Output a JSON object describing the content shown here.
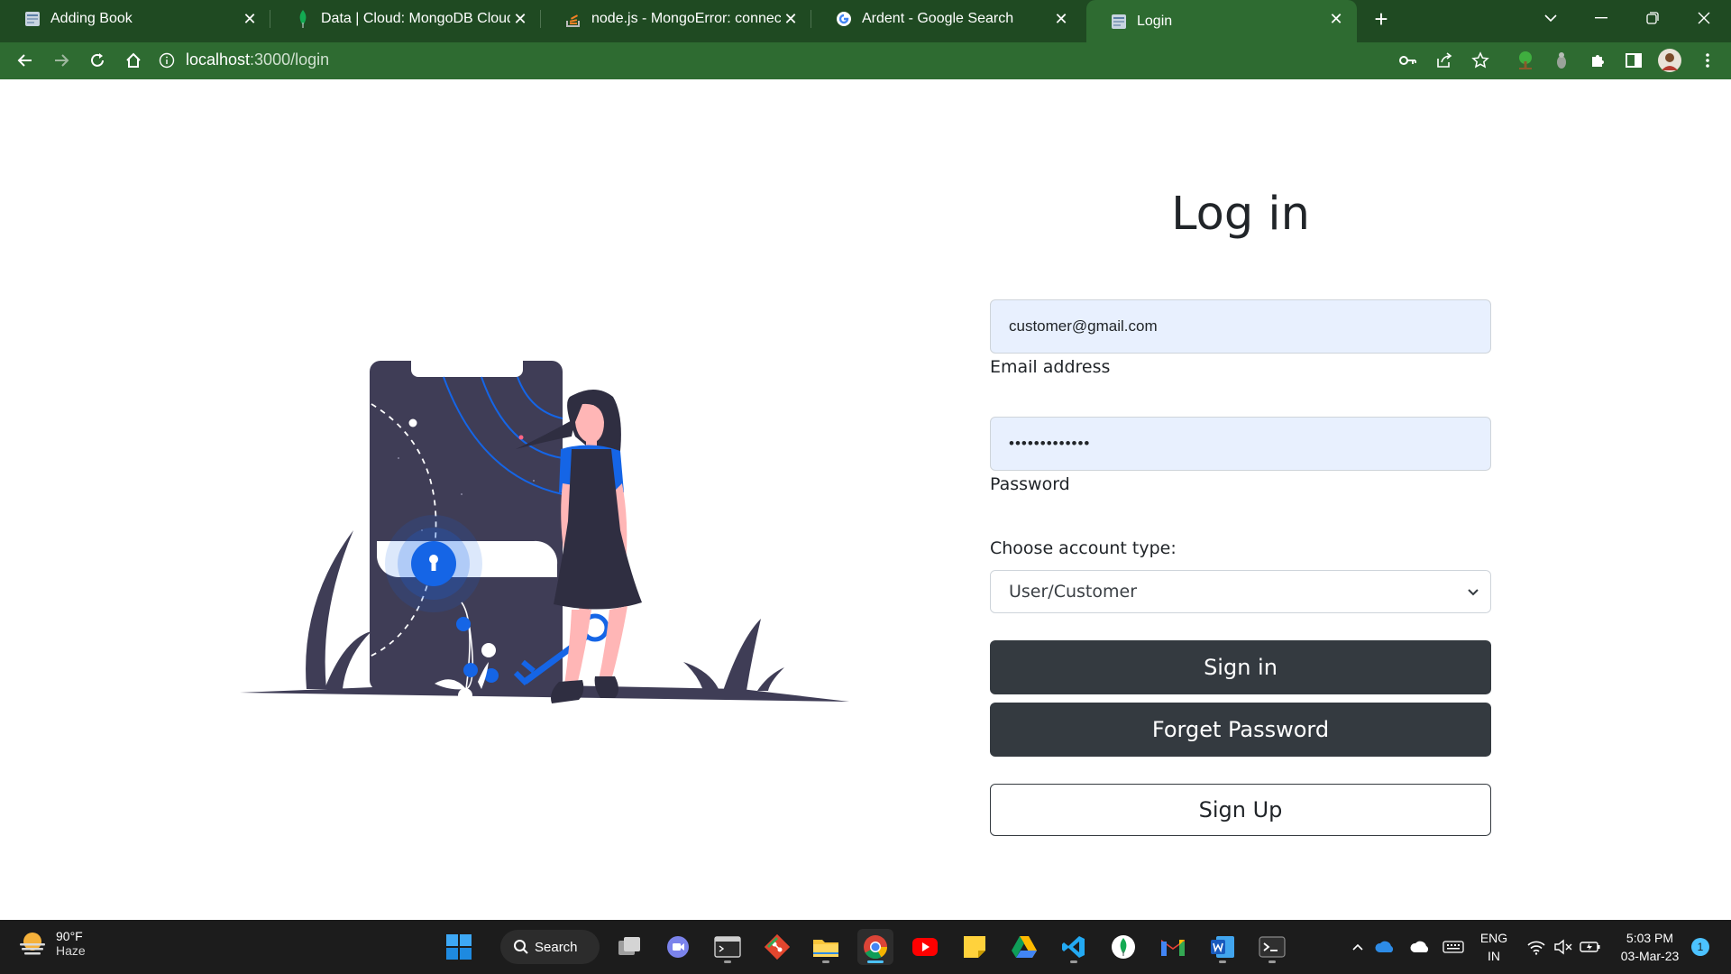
{
  "browser": {
    "tabs": [
      {
        "title": "Adding Book",
        "icon": "page-icon",
        "active": false
      },
      {
        "title": "Data | Cloud: MongoDB Cloud",
        "icon": "mongodb-leaf-icon",
        "active": false
      },
      {
        "title": "node.js - MongoError: connect E",
        "icon": "stackoverflow-icon",
        "active": false
      },
      {
        "title": "Ardent - Google Search",
        "icon": "google-icon",
        "active": false
      },
      {
        "title": "Login",
        "icon": "page-icon",
        "active": true
      }
    ],
    "new_tab": "+",
    "address": {
      "host": "localhost",
      "path": ":3000/login"
    }
  },
  "page": {
    "heading": "Log in",
    "email": {
      "value": "customer@gmail.com",
      "label": "Email address"
    },
    "password": {
      "value": "•••••••••••••",
      "label": "Password"
    },
    "account_type": {
      "label": "Choose account type:",
      "selected": "User/Customer"
    },
    "buttons": {
      "sign_in": "Sign in",
      "forget_password": "Forget Password",
      "sign_up": "Sign Up"
    }
  },
  "taskbar": {
    "weather": {
      "temp": "90°F",
      "condition": "Haze"
    },
    "search_label": "Search",
    "language": {
      "line1": "ENG",
      "line2": "IN"
    },
    "clock": {
      "time": "5:03 PM",
      "date": "03-Mar-23"
    },
    "notification_count": "1"
  },
  "colors": {
    "browser_frame": "#1f4a22",
    "browser_toolbar": "#2e6b31",
    "button_dark": "#343a40",
    "autofill_bg": "#e8f0fe",
    "illustration_accent": "#1565e6",
    "illustration_dark": "#3f3d56"
  }
}
